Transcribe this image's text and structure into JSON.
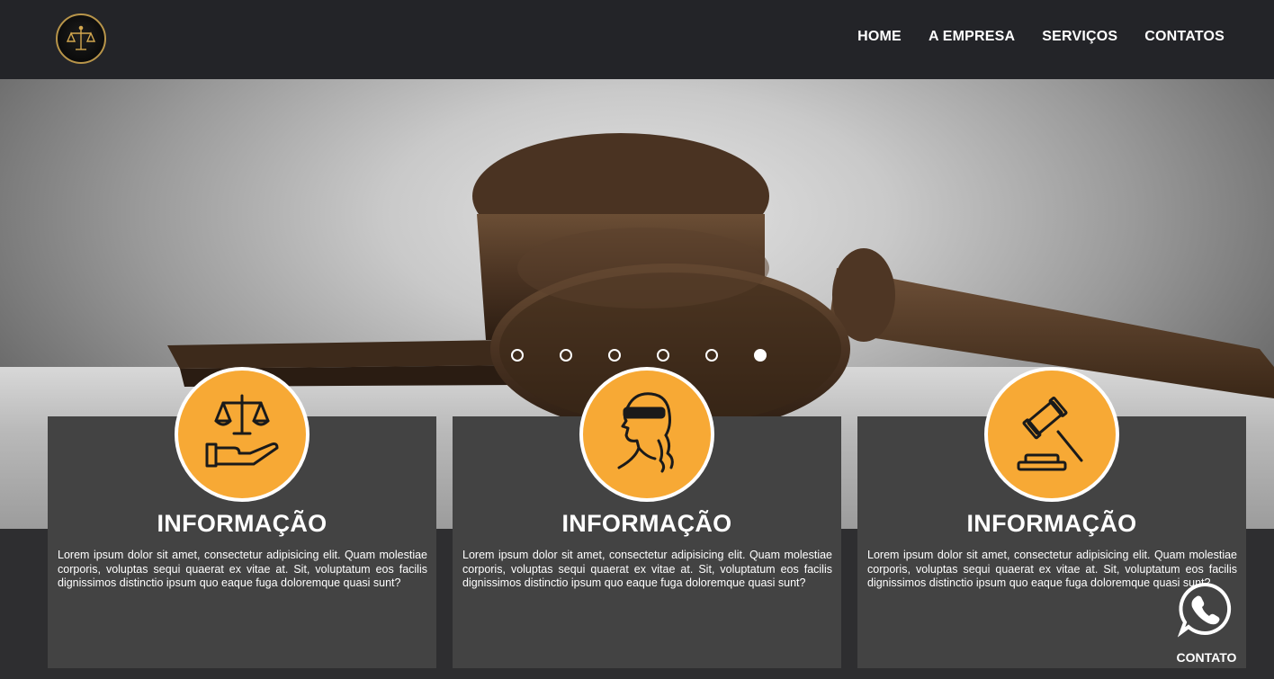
{
  "header": {
    "logo_icon": "scales-of-justice-icon",
    "nav": [
      "HOME",
      "A EMPRESA",
      "SERVIÇOS",
      "CONTATOS"
    ]
  },
  "hero": {
    "image": "judge-gavel",
    "slides": 6,
    "active_slide": 6
  },
  "cards": [
    {
      "icon": "scales-in-hand-icon",
      "title": "INFORMAÇÃO",
      "text": "Lorem ipsum dolor sit amet, consectetur adipisicing elit. Quam molestiae corporis, voluptas sequi quaerat ex vitae at. Sit, voluptatum eos facilis dignissimos distinctio ipsum quo eaque fuga doloremque quasi sunt?"
    },
    {
      "icon": "lady-justice-icon",
      "title": "INFORMAÇÃO",
      "text": "Lorem ipsum dolor sit amet, consectetur adipisicing elit. Quam molestiae corporis, voluptas sequi quaerat ex vitae at. Sit, voluptatum eos facilis dignissimos distinctio ipsum quo eaque fuga doloremque quasi sunt?"
    },
    {
      "icon": "gavel-icon",
      "title": "INFORMAÇÃO",
      "text": "Lorem ipsum dolor sit amet, consectetur adipisicing elit. Quam molestiae corporis, voluptas sequi quaerat ex vitae at. Sit, voluptatum eos facilis dignissimos distinctio ipsum quo eaque fuga doloremque quasi sunt?"
    }
  ],
  "whatsapp": {
    "icon": "whatsapp-icon",
    "label": "CONTATO"
  },
  "colors": {
    "header_bg": "#232428",
    "card_bg": "#434343",
    "accent": "#f7a935",
    "page_bg": "#2e2e30"
  }
}
